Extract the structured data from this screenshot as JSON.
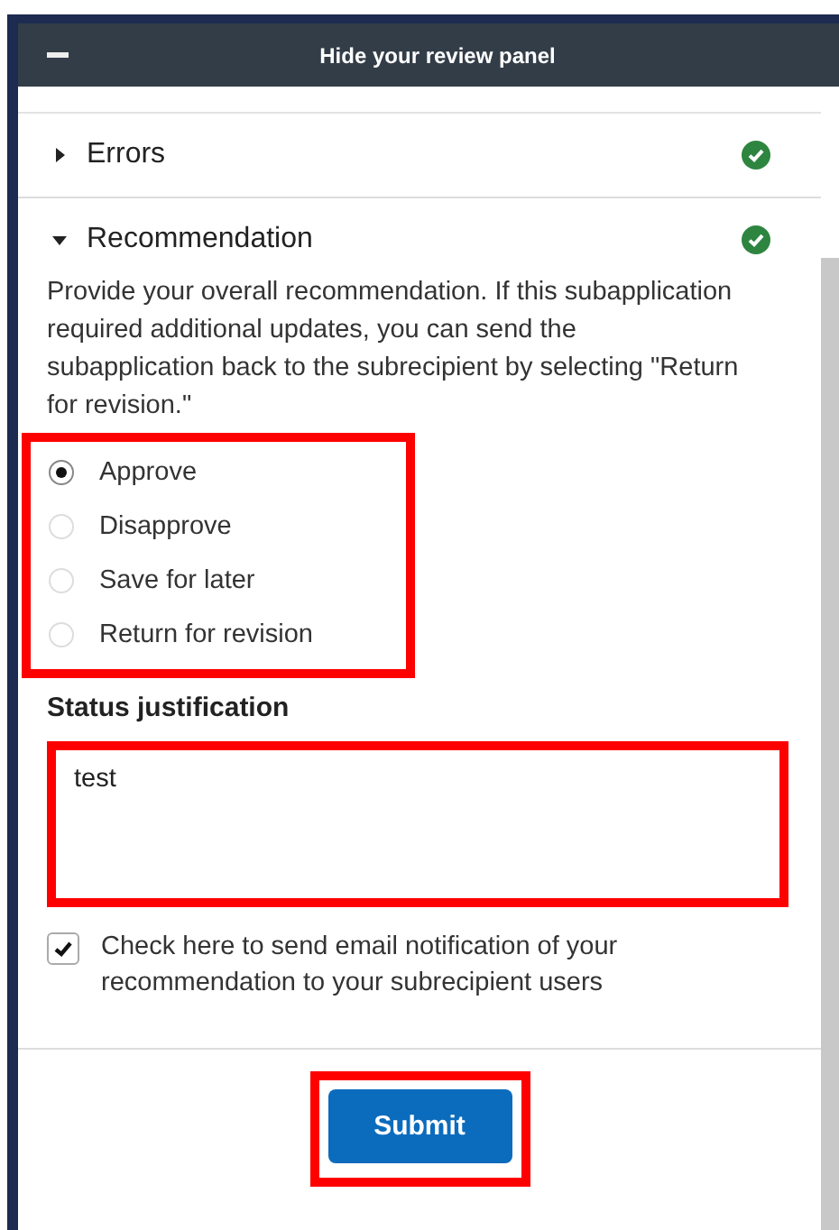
{
  "header": {
    "title": "Hide your review panel"
  },
  "sections": [
    {
      "title": "Errors",
      "expanded": false,
      "complete": true
    },
    {
      "title": "Recommendation",
      "expanded": true,
      "complete": true
    }
  ],
  "recommendation": {
    "description": "Provide your overall recommendation. If this subapplication required additional updates, you can send the subapplication back to the subrecipient by selecting \"Return for revision.\"",
    "highlighted": true,
    "options": [
      {
        "label": "Approve",
        "selected": true
      },
      {
        "label": "Disapprove",
        "selected": false
      },
      {
        "label": "Save for later",
        "selected": false
      },
      {
        "label": "Return for revision",
        "selected": false
      }
    ]
  },
  "justification": {
    "label": "Status justification",
    "value": "test",
    "highlighted": true
  },
  "notify": {
    "label": "Check here to send email notification of your recommendation to your subrecipient users",
    "checked": true
  },
  "submit": {
    "label": "Submit",
    "highlighted": true
  }
}
